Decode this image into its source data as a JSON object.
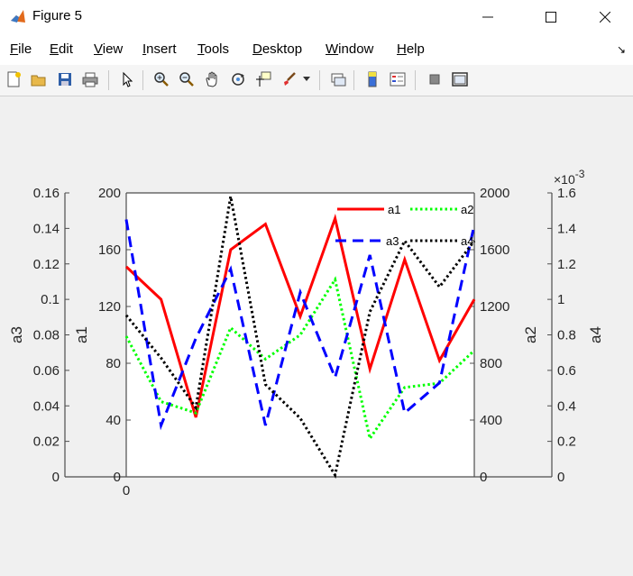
{
  "window": {
    "title": "Figure 5",
    "minimize": "—",
    "maximize": "☐",
    "close": "✕"
  },
  "menu": {
    "items": [
      {
        "first": "F",
        "rest": "ile"
      },
      {
        "first": "E",
        "rest": "dit"
      },
      {
        "first": "V",
        "rest": "iew"
      },
      {
        "first": "I",
        "rest": "nsert"
      },
      {
        "first": "T",
        "rest": "ools"
      },
      {
        "first": "D",
        "rest": "esktop"
      },
      {
        "first": "W",
        "rest": "indow"
      },
      {
        "first": "H",
        "rest": "elp"
      }
    ],
    "overflow": "↘"
  },
  "toolbar": {
    "buttons": [
      "new-figure-icon",
      "open-file-icon",
      "save-icon",
      "print-icon",
      "select-arrow-icon",
      "zoom-in-icon",
      "zoom-out-icon",
      "pan-hand-icon",
      "rotate-3d-icon",
      "data-cursor-icon",
      "brush-icon",
      "link-plot-icon",
      "colorbar-icon",
      "legend-icon",
      "hide-tools-icon",
      "dock-figure-icon"
    ]
  },
  "colors": {
    "a1": "#ff0000",
    "a2": "#00ff00",
    "a3": "#0000ff",
    "a4": "#000000",
    "axis": "#4d4d4d",
    "plotBg": "#ffffff",
    "figureBg": "#f0f0f0"
  },
  "chart_data": {
    "type": "line",
    "x": [
      1,
      2,
      3,
      4,
      5,
      6,
      7,
      8,
      9,
      10,
      11
    ],
    "x_tick_labels": [
      "0"
    ],
    "grid": false,
    "legend_placement": "top-right",
    "series": [
      {
        "name": "a1",
        "axis": "a1",
        "style": "solid",
        "values": [
          148,
          125,
          42,
          160,
          178,
          113,
          182,
          76,
          153,
          82,
          125
        ]
      },
      {
        "name": "a2",
        "axis": "a2",
        "style": "dotted",
        "values": [
          990,
          530,
          450,
          1050,
          830,
          1000,
          1390,
          270,
          630,
          660,
          890
        ]
      },
      {
        "name": "a3",
        "axis": "a3",
        "style": "dashed",
        "values": [
          0.145,
          0.029,
          0.078,
          0.117,
          0.029,
          0.104,
          0.056,
          0.125,
          0.036,
          0.053,
          0.142
        ]
      },
      {
        "name": "a4",
        "axis": "a4",
        "style": "dotted",
        "values": [
          0.00091,
          0.00067,
          0.00039,
          0.00158,
          0.00052,
          0.00033,
          1e-05,
          0.00093,
          0.00133,
          0.00107,
          0.00133
        ]
      }
    ],
    "axes": {
      "a1": {
        "label": "a1",
        "side": "left",
        "ylim": [
          0,
          200
        ],
        "ticks": [
          "0",
          "40",
          "80",
          "120",
          "160",
          "200"
        ],
        "tick_values": [
          0,
          40,
          80,
          120,
          160,
          200
        ]
      },
      "a2": {
        "label": "a2",
        "side": "right",
        "ylim": [
          0,
          2000
        ],
        "ticks": [
          "0",
          "400",
          "800",
          "1200",
          "1600",
          "2000"
        ],
        "tick_values": [
          0,
          400,
          800,
          1200,
          1600,
          2000
        ]
      },
      "a3": {
        "label": "a3",
        "side": "left-outer",
        "ylim": [
          0,
          0.16
        ],
        "ticks": [
          "0",
          "0.02",
          "0.04",
          "0.06",
          "0.08",
          "0.1",
          "0.12",
          "0.14",
          "0.16"
        ],
        "tick_values": [
          0,
          0.02,
          0.04,
          0.06,
          0.08,
          0.1,
          0.12,
          0.14,
          0.16
        ]
      },
      "a4": {
        "label": "a4",
        "side": "right-outer",
        "ylim": [
          0,
          0.0016
        ],
        "ticks": [
          "0",
          "0.2",
          "0.4",
          "0.6",
          "0.8",
          "1",
          "1.2",
          "1.4",
          "1.6"
        ],
        "tick_values": [
          0,
          0.0002,
          0.0004,
          0.0006,
          0.0008,
          0.001,
          0.0012,
          0.0014,
          0.0016
        ],
        "exponent_base": "×10",
        "exponent_power": "-3"
      }
    }
  }
}
